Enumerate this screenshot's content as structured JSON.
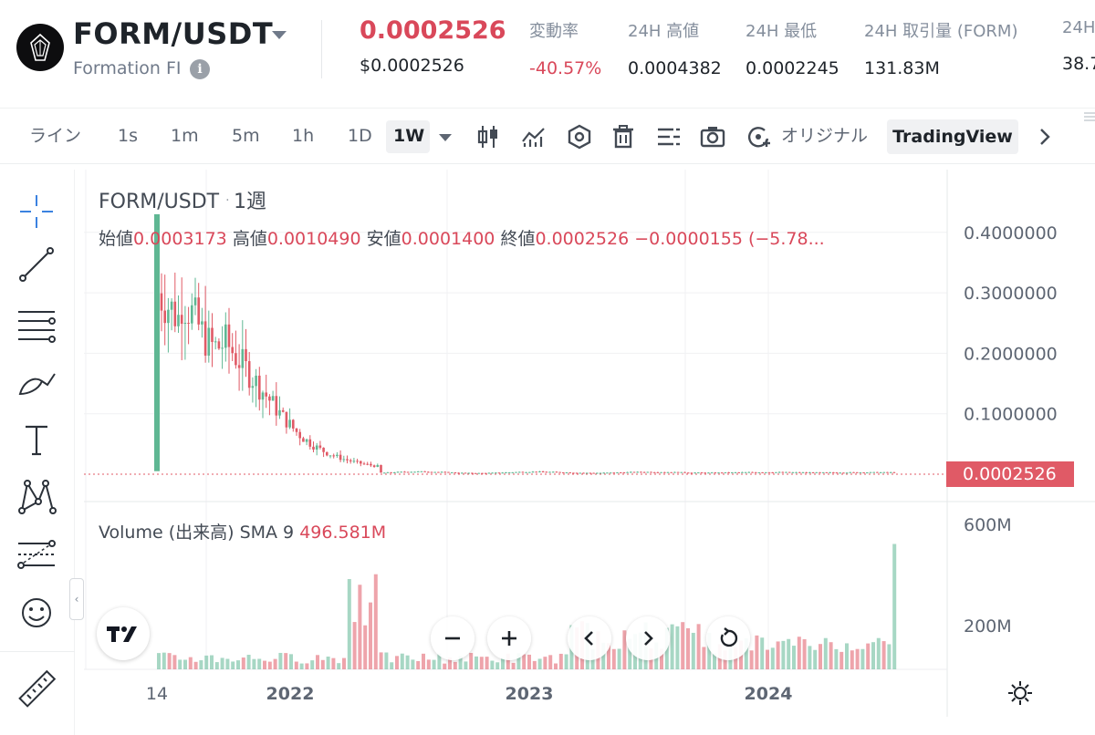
{
  "header": {
    "pair": "FORM/USDT",
    "name": "Formation FI",
    "price": "0.0002526",
    "price_usd": "$0.0002526",
    "stats": [
      {
        "label": "変動率",
        "value": "-40.57%",
        "negative": true
      },
      {
        "label": "24H 高値",
        "value": "0.0004382"
      },
      {
        "label": "24H 最低",
        "value": "0.0002245"
      },
      {
        "label": "24H 取引量 (FORM)",
        "value": "131.83M"
      },
      {
        "label": "24H",
        "value": "38.7"
      }
    ]
  },
  "toolbar": {
    "line": "ライン",
    "intervals": [
      "1s",
      "1m",
      "5m",
      "1h",
      "1D",
      "1W"
    ],
    "active_interval": "1W",
    "original": "オリジナル",
    "tradingview": "TradingView"
  },
  "chart": {
    "title": "FORM/USDT",
    "period": "1週",
    "ohlc": {
      "open_label": "始値",
      "open": "0.0003173",
      "high_label": "高値",
      "high": "0.0010490",
      "low_label": "安値",
      "low": "0.0001400",
      "close_label": "終値",
      "close": "0.0002526",
      "change": "−0.0000155 (−5.78..."
    },
    "volume_legend": "Volume (出来高) SMA 9",
    "volume_sma": "496.581M",
    "price_axis": [
      "0.4000000",
      "0.3000000",
      "0.2000000",
      "0.1000000"
    ],
    "last_price_tag": "0.0002526",
    "volume_axis": [
      "600M",
      "200M"
    ],
    "time_axis": [
      "14",
      "2022",
      "2023",
      "2024"
    ]
  },
  "chart_data": {
    "type": "candlestick",
    "title": "FORM/USDT",
    "interval": "1W",
    "y_ticks": [
      0.1,
      0.2,
      0.3,
      0.4
    ],
    "ylim": [
      0,
      0.43
    ],
    "volume_ticks_M": [
      200,
      600
    ],
    "last_price": 0.0002526,
    "x_ticks": [
      "14",
      "2022",
      "2023",
      "2024"
    ],
    "approx_peak_price": 0.44,
    "approx_start_low": 0.01
  },
  "colors": {
    "up": "#5fb793",
    "down": "#e05a66",
    "accent": "#d9485a"
  }
}
